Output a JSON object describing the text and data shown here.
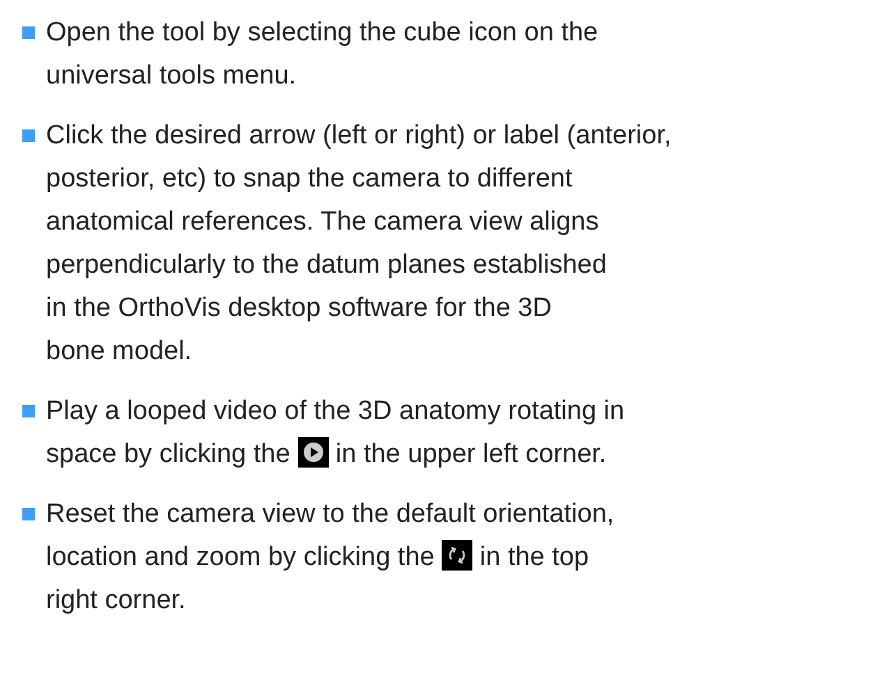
{
  "steps": [
    {
      "before": "Open the tool by selecting the cube icon on the\nuniversal tools menu."
    },
    {
      "before": "Click the desired arrow (left or right) or label (anterior,\nposterior, etc) to snap the camera to different\nanatomical references. The camera view aligns\nperpendicularly to the datum planes established\nin the OrthoVis desktop software for the 3D\nbone model."
    },
    {
      "before": "Play a looped video of the 3D anatomy rotating in\nspace by clicking the ",
      "kind": "play",
      "after": " in the upper left corner."
    },
    {
      "before": "Reset the camera view to the default orientation,\nlocation and zoom by clicking the ",
      "kind": "reset",
      "after": " in the top\nright corner."
    }
  ]
}
